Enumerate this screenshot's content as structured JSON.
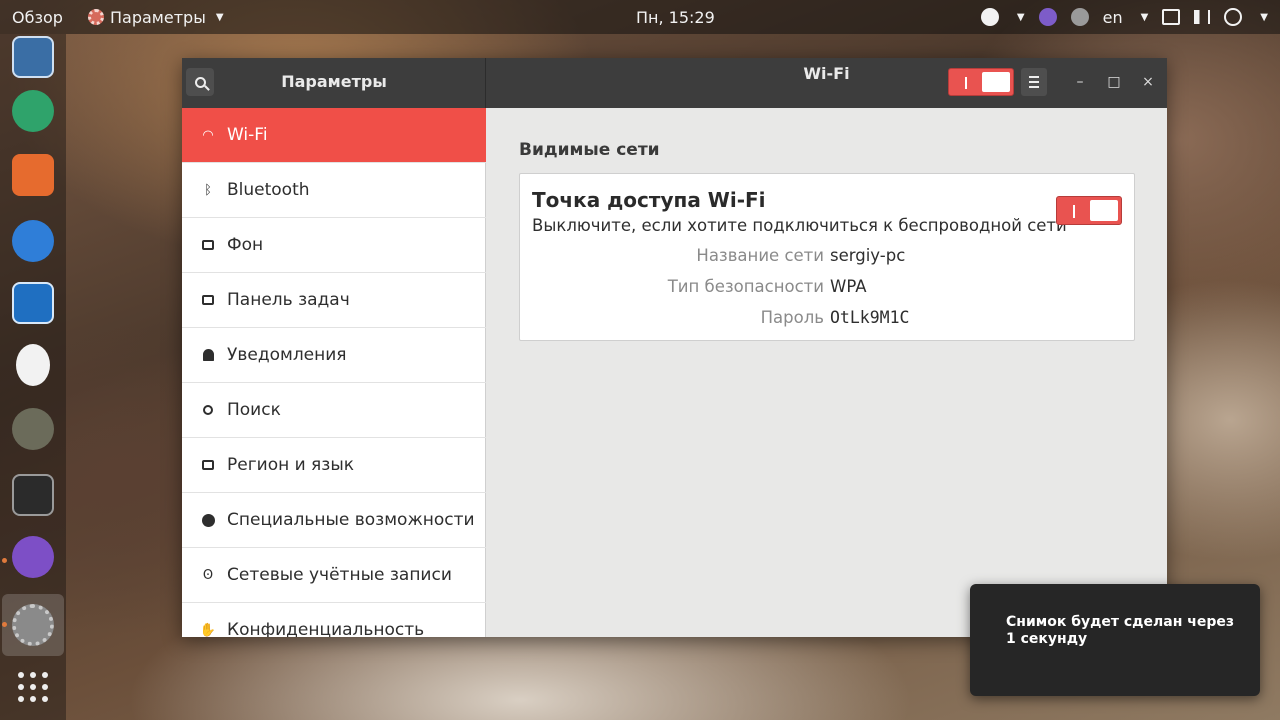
{
  "topbar": {
    "overview": "Обзор",
    "app_menu": "Параметры",
    "clock": "Пн, 15:29",
    "language": "en"
  },
  "dock": {
    "apps": [
      "document-viewer",
      "atom",
      "software-center",
      "help",
      "system-monitor",
      "timer",
      "gimp",
      "terminal",
      "viber",
      "settings"
    ]
  },
  "window": {
    "sidebar_title": "Параметры",
    "page_title": "Wi-Fi",
    "hotspot_enabled": true
  },
  "sidebar": {
    "items": [
      {
        "label": "Wi-Fi",
        "icon": "wifi-icon"
      },
      {
        "label": "Bluetooth",
        "icon": "bluetooth-icon"
      },
      {
        "label": "Фон",
        "icon": "background-icon"
      },
      {
        "label": "Панель задач",
        "icon": "dock-icon"
      },
      {
        "label": "Уведомления",
        "icon": "bell-icon"
      },
      {
        "label": "Поиск",
        "icon": "search-icon"
      },
      {
        "label": "Регион и язык",
        "icon": "region-icon"
      },
      {
        "label": "Специальные возможности",
        "icon": "accessibility-icon"
      },
      {
        "label": "Сетевые учётные записи",
        "icon": "online-accounts-icon"
      },
      {
        "label": "Конфиденциальность",
        "icon": "privacy-icon"
      }
    ]
  },
  "content": {
    "section_title": "Видимые сети",
    "hotspot": {
      "title": "Точка доступа Wi-Fi",
      "subtitle": "Выключите, если хотите подключиться к беспроводной сети",
      "enabled": true,
      "rows": [
        {
          "label": "Название сети",
          "value": "sergiy-pc"
        },
        {
          "label": "Тип безопасности",
          "value": "WPA"
        },
        {
          "label": "Пароль",
          "value": "OtLk9M1C"
        }
      ]
    }
  },
  "notification": {
    "text": "Снимок будет сделан через 1 секунду"
  },
  "colors": {
    "accent": "#f04f48",
    "header": "#3d3d3d",
    "content_bg": "#e8e8e7"
  }
}
